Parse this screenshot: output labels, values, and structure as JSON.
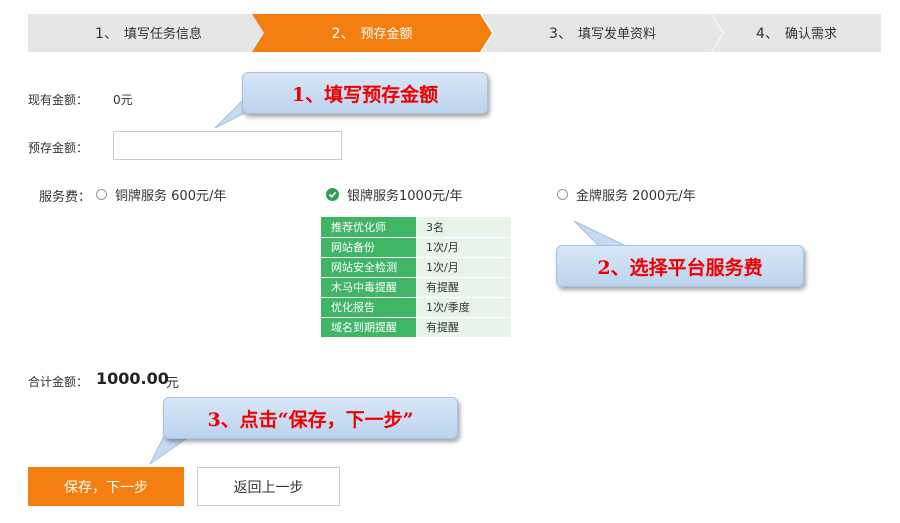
{
  "steps": [
    {
      "num": "1、",
      "label": "填写任务信息",
      "active": false
    },
    {
      "num": "2、",
      "label": "预存金额",
      "active": true
    },
    {
      "num": "3、",
      "label": "填写发单资料",
      "active": false
    },
    {
      "num": "4、",
      "label": "确认需求",
      "active": false
    }
  ],
  "colors": {
    "active_step": "#f27f10",
    "inactive_step": "#e6e6e6",
    "table_key": "#3fb566",
    "table_value": "#e6f4ea",
    "callout_text": "#e00000"
  },
  "form": {
    "current_amount_label": "现有金额：",
    "current_amount_value": "0元",
    "deposit_label": "预存金额：",
    "deposit_value": "",
    "service_fee_label": "服务费："
  },
  "services": [
    {
      "name": "铜牌服务",
      "price": "600元/年",
      "selected": false
    },
    {
      "name": "银牌服务",
      "price": "1000元/年",
      "selected": true
    },
    {
      "name": "金牌服务",
      "price": "2000元/年",
      "selected": false
    }
  ],
  "service_details": [
    {
      "k": "推荐优化师",
      "v": "3名"
    },
    {
      "k": "网站备份",
      "v": "1次/月"
    },
    {
      "k": "网站安全检测",
      "v": "1次/月"
    },
    {
      "k": "木马中毒提醒",
      "v": "有提醒"
    },
    {
      "k": "优化报告",
      "v": "1次/季度"
    },
    {
      "k": "域名到期提醒",
      "v": "有提醒"
    }
  ],
  "total": {
    "label": "合计金额：",
    "value": "1000.00",
    "unit": "元"
  },
  "callouts": {
    "c1": "1、填写预存金额",
    "c2": "2、选择平台服务费",
    "c3": "3、点击“保存，下一步”"
  },
  "buttons": {
    "save": "保存，下一步",
    "back": "返回上一步"
  }
}
